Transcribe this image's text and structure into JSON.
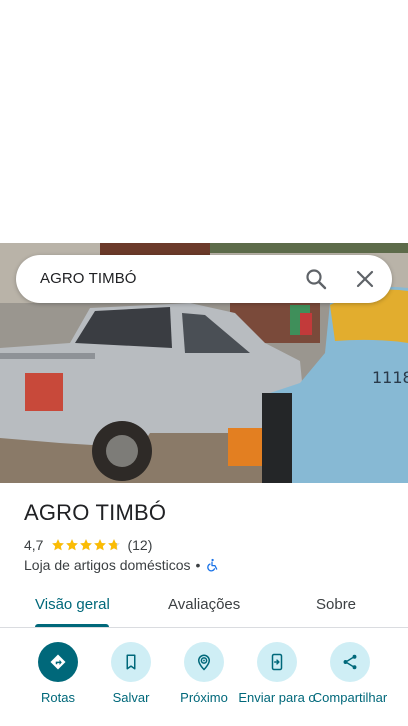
{
  "search": {
    "query": "AGRO TIMBÓ"
  },
  "place": {
    "name": "AGRO TIMBÓ",
    "rating": "4,7",
    "star_fill": 4.7,
    "review_count": "(12)",
    "category": "Loja de artigos domésticos",
    "separator": "•"
  },
  "tabs": [
    {
      "label": "Visão geral",
      "active": true
    },
    {
      "label": "Avaliações",
      "active": false
    },
    {
      "label": "Sobre",
      "active": false
    }
  ],
  "actions": [
    {
      "label": "Rotas",
      "icon": "directions-icon"
    },
    {
      "label": "Salvar",
      "icon": "bookmark-icon"
    },
    {
      "label": "Próximo",
      "icon": "nearby-icon"
    },
    {
      "label": "Enviar para o",
      "icon": "send-to-phone-icon"
    },
    {
      "label": "Compartilhar",
      "icon": "share-icon"
    }
  ],
  "colors": {
    "accent": "#00687a",
    "chip_bg": "#cfeef5",
    "star": "#fbbc04",
    "a11y": "#1a73e8"
  }
}
